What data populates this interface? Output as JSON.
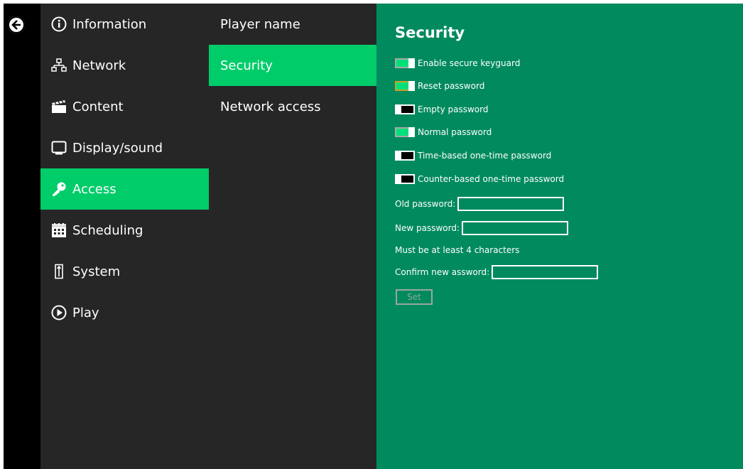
{
  "back": {
    "icon": "arrow-left-circle-icon"
  },
  "nav": {
    "items": [
      {
        "label": "Information",
        "icon": "info-icon"
      },
      {
        "label": "Network",
        "icon": "network-icon"
      },
      {
        "label": "Content",
        "icon": "clapperboard-icon"
      },
      {
        "label": "Display/sound",
        "icon": "monitor-icon"
      },
      {
        "label": "Access",
        "icon": "key-icon",
        "active": true
      },
      {
        "label": "Scheduling",
        "icon": "calendar-icon"
      },
      {
        "label": "System",
        "icon": "system-icon"
      },
      {
        "label": "Play",
        "icon": "play-icon"
      }
    ]
  },
  "subnav": {
    "items": [
      {
        "label": "Player name"
      },
      {
        "label": "Security",
        "active": true
      },
      {
        "label": "Network access"
      }
    ]
  },
  "panel": {
    "title": "Security",
    "toggles": [
      {
        "label": "Enable secure keyguard",
        "on": true
      },
      {
        "label": "Reset password",
        "on": true,
        "focused": true
      },
      {
        "label": "Empty password",
        "on": false
      },
      {
        "label": "Normal password",
        "on": true
      },
      {
        "label": "Time-based one-time password",
        "on": false
      },
      {
        "label": "Counter-based one-time password",
        "on": false
      }
    ],
    "old_password": {
      "label": "Old password:",
      "value": ""
    },
    "new_password": {
      "label": "New password:",
      "value": ""
    },
    "hint": "Must be at least 4 characters",
    "confirm_password": {
      "label": "Confirm new assword:",
      "value": ""
    },
    "set_label": "Set"
  },
  "colors": {
    "accent": "#00cc6a",
    "panel": "#008a5e",
    "sidebar": "#262626",
    "backbar": "#000000"
  }
}
